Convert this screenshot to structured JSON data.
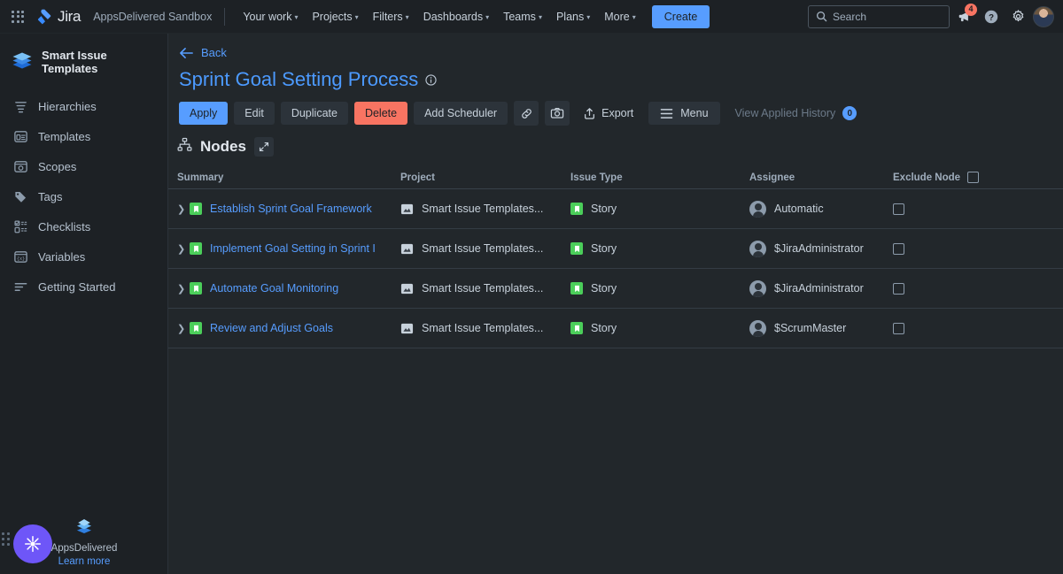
{
  "topnav": {
    "apps_icon": "apps-grid-icon",
    "product": "Jira",
    "site": "AppsDelivered Sandbox",
    "items": [
      {
        "label": "Your work",
        "caret": "▾"
      },
      {
        "label": "Projects",
        "caret": "▾"
      },
      {
        "label": "Filters",
        "caret": "▾"
      },
      {
        "label": "Dashboards",
        "caret": "▾"
      },
      {
        "label": "Teams",
        "caret": "▾"
      },
      {
        "label": "Plans",
        "caret": "▾"
      },
      {
        "label": "More",
        "caret": "▾"
      }
    ],
    "create_label": "Create",
    "search_placeholder": "Search",
    "notification_count": "4",
    "accent_blue": "#579dff",
    "notification_red": "#f87462"
  },
  "sidebar": {
    "title": "Smart Issue Templates",
    "items": [
      {
        "label": "Hierarchies",
        "icon": "hierarchies-icon"
      },
      {
        "label": "Templates",
        "icon": "templates-icon"
      },
      {
        "label": "Scopes",
        "icon": "scopes-icon"
      },
      {
        "label": "Tags",
        "icon": "tag-icon"
      },
      {
        "label": "Checklists",
        "icon": "checklist-icon"
      },
      {
        "label": "Variables",
        "icon": "variables-icon"
      },
      {
        "label": "Getting Started",
        "icon": "getting-started-icon"
      }
    ],
    "promo": {
      "name": "AppsDelivered",
      "learn_more": "Learn more"
    }
  },
  "main": {
    "back_label": "Back",
    "page_title": "Sprint Goal Setting Process",
    "toolbar": {
      "apply": "Apply",
      "edit": "Edit",
      "duplicate": "Duplicate",
      "delete": "Delete",
      "add_scheduler": "Add Scheduler",
      "link_icon": "link-icon",
      "camera_icon": "camera-icon",
      "export": "Export",
      "menu": "Menu",
      "view_applied_history": "View Applied History",
      "history_count": "0"
    },
    "nodes_label": "Nodes",
    "table": {
      "headers": [
        "Summary",
        "Project",
        "Issue Type",
        "Assignee",
        "Exclude Node"
      ],
      "rows": [
        {
          "summary": "Establish Sprint Goal Framework",
          "project": "Smart Issue Templates...",
          "issue_type": "Story",
          "assignee": "Automatic"
        },
        {
          "summary": "Implement Goal Setting in Sprint I",
          "project": "Smart Issue Templates...",
          "issue_type": "Story",
          "assignee": "$JiraAdministrator"
        },
        {
          "summary": "Automate Goal Monitoring",
          "project": "Smart Issue Templates...",
          "issue_type": "Story",
          "assignee": "$JiraAdministrator"
        },
        {
          "summary": "Review and Adjust Goals",
          "project": "Smart Issue Templates...",
          "issue_type": "Story",
          "assignee": "$ScrumMaster"
        }
      ]
    }
  }
}
